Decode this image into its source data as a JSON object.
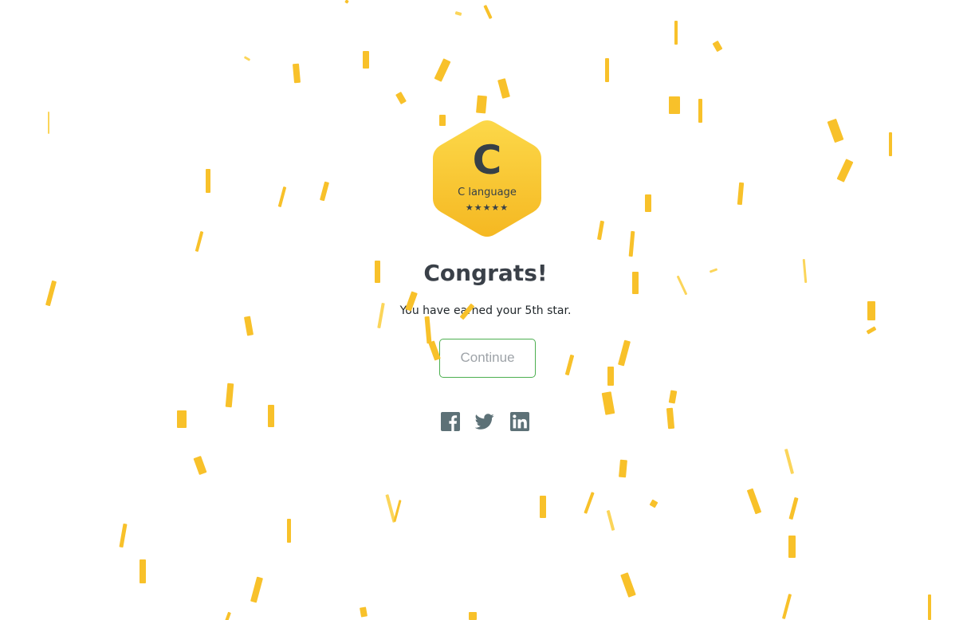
{
  "badge": {
    "letter": "C",
    "name": "C language",
    "stars": "★★★★★",
    "star_rating": 5,
    "star_max": 5,
    "gradient_top": "#fbd341",
    "gradient_bottom": "#f5b922"
  },
  "title": "Congrats!",
  "message": "You have earned your 5th star.",
  "continue_label": "Continue",
  "share": {
    "icons": [
      "facebook-icon",
      "twitter-icon",
      "linkedin-icon"
    ],
    "icon_color": "#5d7177"
  },
  "colors": {
    "confetti": "#f8c12a",
    "confetti_light": "#fbd55a",
    "button_border": "#4caf50",
    "text_dark": "#3a4048"
  }
}
